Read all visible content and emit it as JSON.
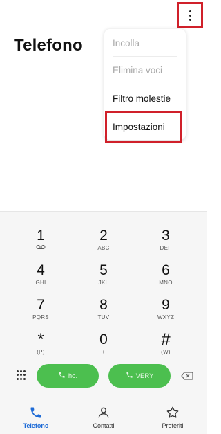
{
  "header": {
    "title": "Telefono"
  },
  "menu": {
    "items": [
      {
        "label": "Incolla",
        "enabled": false
      },
      {
        "label": "Elimina voci",
        "enabled": false
      },
      {
        "label": "Filtro molestie",
        "enabled": true
      },
      {
        "label": "Impostazioni",
        "enabled": true
      }
    ]
  },
  "keypad": {
    "keys": [
      {
        "digit": "1",
        "sub": "ϖ"
      },
      {
        "digit": "2",
        "sub": "ABC"
      },
      {
        "digit": "3",
        "sub": "DEF"
      },
      {
        "digit": "4",
        "sub": "GHI"
      },
      {
        "digit": "5",
        "sub": "JKL"
      },
      {
        "digit": "6",
        "sub": "MNO"
      },
      {
        "digit": "7",
        "sub": "PQRS"
      },
      {
        "digit": "8",
        "sub": "TUV"
      },
      {
        "digit": "9",
        "sub": "WXYZ"
      },
      {
        "digit": "*",
        "sub": "(P)"
      },
      {
        "digit": "0",
        "sub": "+"
      },
      {
        "digit": "#",
        "sub": "(W)"
      }
    ]
  },
  "call_buttons": [
    {
      "label": "ho."
    },
    {
      "label": "VERY"
    }
  ],
  "nav": {
    "items": [
      {
        "label": "Telefono",
        "active": true
      },
      {
        "label": "Contatti",
        "active": false
      },
      {
        "label": "Preferiti",
        "active": false
      }
    ]
  },
  "colors": {
    "accent_blue": "#1e6bd6",
    "call_green": "#4cbf4f",
    "highlight_red": "#d0202a"
  }
}
